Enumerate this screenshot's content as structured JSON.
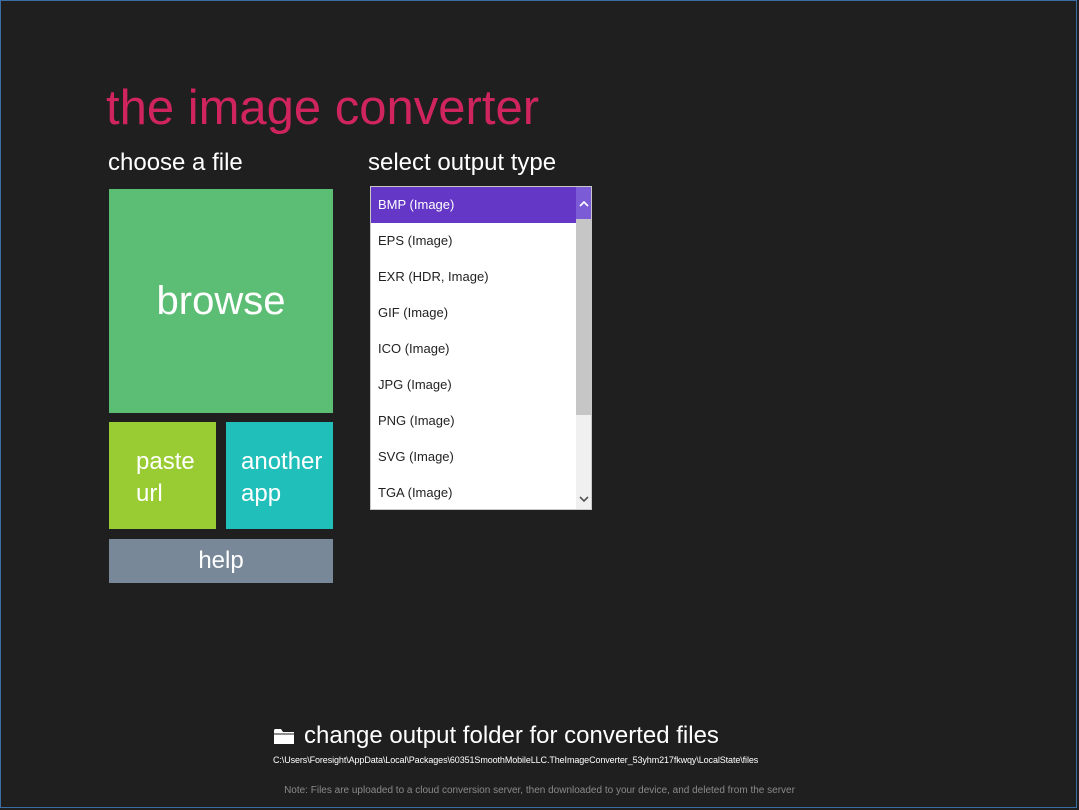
{
  "app": {
    "title": "the image converter"
  },
  "sections": {
    "choose_file_label": "choose a file",
    "select_output_label": "select output type"
  },
  "tiles": {
    "browse": "browse",
    "paste_url_line1": "paste",
    "paste_url_line2": "url",
    "another_app_line1": "another",
    "another_app_line2": "app",
    "help": "help"
  },
  "output_types": {
    "selected_index": 0,
    "items": [
      {
        "label": "BMP (Image)"
      },
      {
        "label": "EPS (Image)"
      },
      {
        "label": "EXR (HDR, Image)"
      },
      {
        "label": "GIF (Image)"
      },
      {
        "label": "ICO (Image)"
      },
      {
        "label": "JPG (Image)"
      },
      {
        "label": "PNG (Image)"
      },
      {
        "label": "SVG (Image)"
      },
      {
        "label": "TGA (Image)"
      }
    ]
  },
  "output_folder": {
    "label": "change output folder for converted files",
    "path": "C:\\Users\\Foresight\\AppData\\Local\\Packages\\60351SmoothMobileLLC.TheImageConverter_53yhm217fkwqy\\LocalState\\files",
    "icon": "folder-icon"
  },
  "footer": {
    "note": "Note: Files are uploaded to a cloud conversion server, then downloaded to your device, and deleted from the server"
  },
  "colors": {
    "title": "#d0245e",
    "browse_tile": "#5cbd74",
    "paste_tile": "#99cc33",
    "another_app_tile": "#21bfba",
    "help_tile": "#788899",
    "selection": "#6437c6",
    "background": "#1f1f1f"
  }
}
